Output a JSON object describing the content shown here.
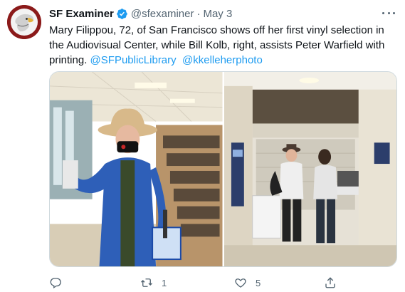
{
  "author": {
    "name": "SF Examiner",
    "handle": "@sfexaminer",
    "date": "May 3"
  },
  "tweet": {
    "text_main": "Mary Filippou, 72, of San Francisco shows off her first vinyl selection in the Audiovisual Center, while Bill Kolb, right, assists Peter Warfield with printing.",
    "mention_1": "@SFPublicLibrary",
    "mention_2": "@kkelleherphoto"
  },
  "media": {
    "photo_left": "woman-with-vinyl-in-library",
    "photo_right": "men-at-print-station"
  },
  "actions": {
    "reply_count": "",
    "retweet_count": "1",
    "like_count": "5",
    "reply_icon": "reply-icon",
    "retweet_icon": "retweet-icon",
    "like_icon": "heart-icon",
    "share_icon": "share-icon"
  },
  "colors": {
    "accent": "#1d9bf0",
    "muted": "#536471",
    "text": "#0f1419"
  }
}
